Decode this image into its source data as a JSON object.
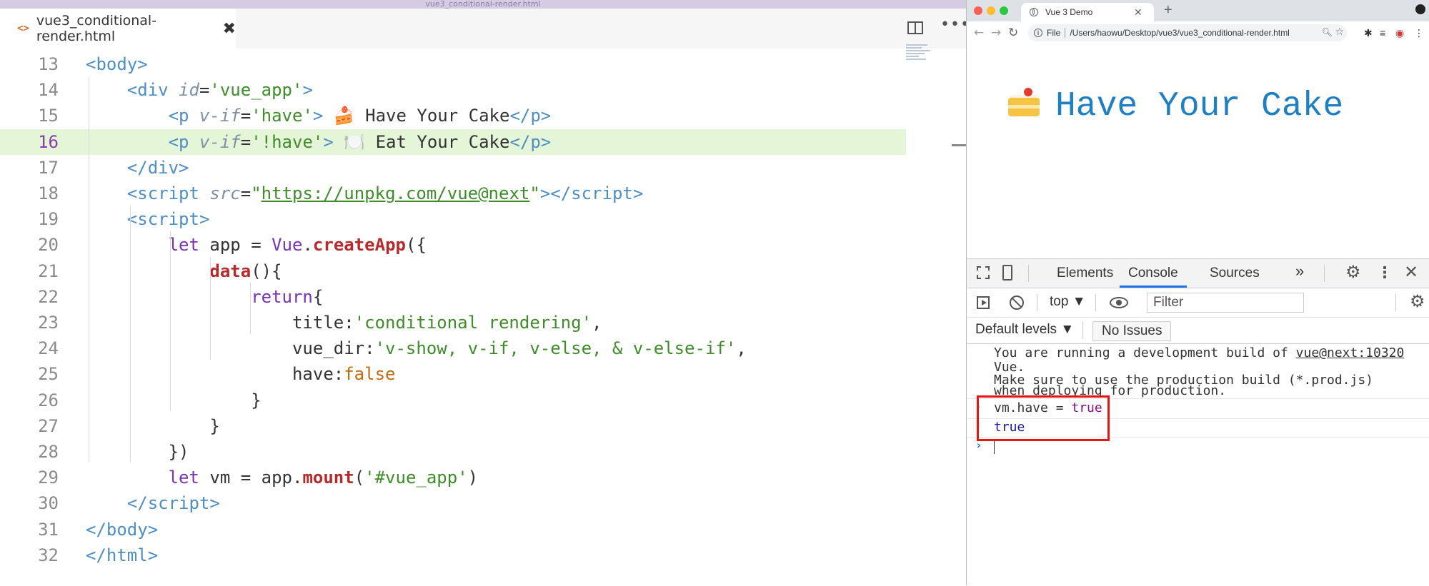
{
  "editor": {
    "window_title": "vue3_conditional-render.html",
    "tab": {
      "icon": "<>",
      "title": "vue3_conditional-render.html",
      "close": "✖"
    },
    "lines": [
      {
        "num": "13",
        "html": "<span class='t-tag'>&lt;body&gt;</span>"
      },
      {
        "num": "14",
        "html": "    <span class='t-tag'>&lt;div</span> <span class='t-attr'>id</span><span class='t-mid'>=</span><span class='t-str'>'vue_app'</span><span class='t-tag'>&gt;</span>"
      },
      {
        "num": "15",
        "html": "        <span class='t-tag'>&lt;p</span> <span class='t-attr'>v-if</span><span class='t-mid'>=</span><span class='t-str'>'have'</span><span class='t-tag'>&gt;</span> 🍰 Have Your Cake<span class='t-tag'>&lt;/p&gt;</span>"
      },
      {
        "num": "16",
        "html": "        <span class='t-tag'>&lt;p</span> <span class='t-attr'>v-if</span><span class='t-mid'>=</span><span class='t-str'>'!have'</span><span class='t-tag'>&gt;</span> 🍽️ Eat Your Cake<span class='t-tag'>&lt;/p&gt;</span>",
        "active": true
      },
      {
        "num": "17",
        "html": "    <span class='t-tag'>&lt;/div&gt;</span>"
      },
      {
        "num": "18",
        "html": "    <span class='t-tag'>&lt;script</span> <span class='t-attr'>src</span><span class='t-mid'>=</span><span class='t-str'>\"</span><span class='t-url'>https://unpkg.com/vue@next</span><span class='t-str'>\"</span><span class='t-tag'>&gt;&lt;/script&gt;</span>"
      },
      {
        "num": "19",
        "html": "    <span class='t-tag'>&lt;script&gt;</span>"
      },
      {
        "num": "20",
        "html": "        <span class='t-kw'>let</span> app = <span class='t-kw'>Vue</span>.<span class='t-fn'>createApp</span>({"
      },
      {
        "num": "21",
        "html": "            <span class='t-fn'>data</span>(){"
      },
      {
        "num": "22",
        "html": "                <span class='t-kw'>return</span>{"
      },
      {
        "num": "23",
        "html": "                    title:<span class='t-str'>'conditional rendering'</span>,"
      },
      {
        "num": "24",
        "html": "                    vue_dir:<span class='t-str'>'v-show, v-if, v-else, &amp; v-else-if'</span>,"
      },
      {
        "num": "25",
        "html": "                    have:<span class='t-bool'>false</span>"
      },
      {
        "num": "26",
        "html": "                }"
      },
      {
        "num": "27",
        "html": "            }"
      },
      {
        "num": "28",
        "html": "        })"
      },
      {
        "num": "29",
        "html": "        <span class='t-kw'>let</span> vm = app.<span class='t-fn'>mount</span>(<span class='t-str'>'#vue_app'</span>)"
      },
      {
        "num": "30",
        "html": "    <span class='t-tag'>&lt;/script&gt;</span>"
      },
      {
        "num": "31",
        "html": "<span class='t-tag'>&lt;/body&gt;</span>"
      },
      {
        "num": "32",
        "html": "<span class='t-tag'>&lt;/html&gt;</span>"
      }
    ]
  },
  "browser": {
    "tab_title": "Vue 3 Demo",
    "tab_close": "✕",
    "new_tab": "+",
    "url_scheme": "File",
    "url_path": "/Users/haowu/Desktop/vue3/vue3_conditional-render.html",
    "page_heading": "Have Your Cake"
  },
  "devtools": {
    "tabs": [
      "Elements",
      "Console",
      "Sources"
    ],
    "more": "»",
    "context": "top ▼",
    "filter_placeholder": "Filter",
    "levels": "Default levels ▼",
    "issues": "No Issues",
    "messages": [
      "You are running a development build of vue@next:10320",
      "Vue.",
      "Make sure to use the production build (*.prod.js)",
      "when deploying for production."
    ],
    "command": {
      "prefix": "vm.have = ",
      "value": "true"
    },
    "result": "true"
  },
  "colors": {
    "highlight": "#e8140f",
    "link": "#1e7fc3",
    "active_line": "#e4f5d8"
  }
}
